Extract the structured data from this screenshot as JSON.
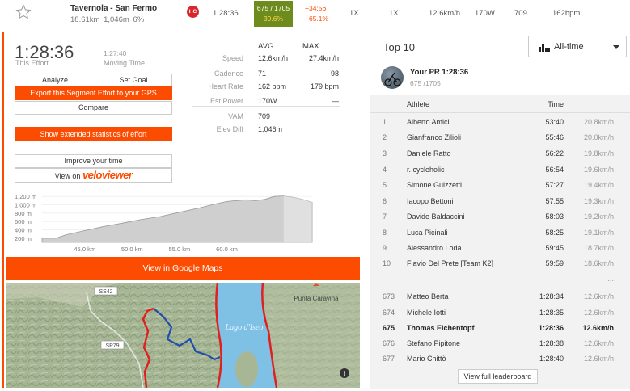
{
  "segment": {
    "name": "Tavernola - San Fermo",
    "distance": "18.61km",
    "elevation": "1,046m",
    "grade": "6%",
    "category": "HC"
  },
  "top_bar": {
    "time": "1:28:36",
    "rank": "675 / 1705",
    "rank_pct": "39.6%",
    "diff_time": "+34:56",
    "diff_pct": "+65.1%",
    "col_a": "1X",
    "col_b": "1X",
    "speed": "12.6km/h",
    "power": "170W",
    "col_c": "709",
    "hr": "162bpm"
  },
  "effort": {
    "time": "1:28:36",
    "time_label": "This Effort",
    "moving_time": "1:27:40",
    "moving_label": "Moving Time"
  },
  "buttons": {
    "analyze": "Analyze",
    "set_goal": "Set Goal",
    "export": "Export this Segment Effort to your GPS",
    "compare": "Compare",
    "extended": "Show extended statistics of effort",
    "improve": "Improve your time",
    "view_on": "View on",
    "veloviewer": "veloviewer",
    "maps": "View in Google Maps",
    "full_leaderboard": "View full leaderboard"
  },
  "stats": {
    "avg_header": "AVG",
    "max_header": "MAX",
    "rows": [
      {
        "label": "Speed",
        "avg": "12.6km/h",
        "max": "27.4km/h"
      },
      {
        "label": "Cadence",
        "avg": "71",
        "max": "98"
      },
      {
        "label": "Heart Rate",
        "avg": "162 bpm",
        "max": "179 bpm"
      },
      {
        "label": "Est Power",
        "avg": "170W",
        "max": "—"
      },
      {
        "label": "VAM",
        "avg": "709",
        "max": ""
      },
      {
        "label": "Elev Diff",
        "avg": "1,046m",
        "max": ""
      }
    ]
  },
  "chart_data": {
    "type": "area",
    "title": "",
    "y_ticks": [
      "1,200 m",
      "1,000 m",
      "800 m",
      "600 m",
      "400 m",
      "200 m"
    ],
    "x_ticks": [
      "45.0 km",
      "50.0 km",
      "55.0 km",
      "60.0 km"
    ],
    "x": [
      40.5,
      42,
      43,
      45,
      47,
      49,
      51,
      53,
      55,
      57,
      59,
      60,
      61,
      62,
      63,
      64,
      65,
      66,
      67,
      68,
      69
    ],
    "y": [
      200,
      200,
      280,
      380,
      480,
      560,
      650,
      720,
      820,
      920,
      1030,
      1080,
      1100,
      1120,
      1100,
      1130,
      1200,
      1210,
      1180,
      1130,
      1060
    ],
    "ylim": [
      100,
      1300
    ],
    "xlim": [
      40.5,
      69
    ]
  },
  "map": {
    "labels": [
      "SS42",
      "SP79",
      "Lago d'Iseo",
      "Punta Caravina"
    ],
    "info": "i"
  },
  "leaderboard": {
    "title": "Top 10",
    "filter": "All-time",
    "pr_label": "Your PR 1:28:36",
    "pr_rank": "675 /1705",
    "headers": {
      "athlete": "Athlete",
      "time": "Time"
    },
    "top": [
      {
        "rank": "1",
        "name": "Alberto Amici",
        "time": "53:40",
        "speed": "20.8km/h"
      },
      {
        "rank": "2",
        "name": "Gianfranco Zilioli",
        "time": "55:46",
        "speed": "20.0km/h"
      },
      {
        "rank": "3",
        "name": "Daniele Ratto",
        "time": "56:22",
        "speed": "19.8km/h"
      },
      {
        "rank": "4",
        "name": "r. cycleholic",
        "time": "56:54",
        "speed": "19.6km/h"
      },
      {
        "rank": "5",
        "name": "Simone Guizzetti",
        "time": "57:27",
        "speed": "19.4km/h"
      },
      {
        "rank": "6",
        "name": "Iacopo Bettoni",
        "time": "57:55",
        "speed": "19.3km/h"
      },
      {
        "rank": "7",
        "name": "Davide Baldaccini",
        "time": "58:03",
        "speed": "19.2km/h"
      },
      {
        "rank": "8",
        "name": "Luca Picinali",
        "time": "58:25",
        "speed": "19.1km/h"
      },
      {
        "rank": "9",
        "name": "Alessandro Loda",
        "time": "59:45",
        "speed": "18.7km/h"
      },
      {
        "rank": "10",
        "name": "Flavio Del Prete [Team K2]",
        "time": "59:59",
        "speed": "18.6km/h"
      }
    ],
    "ellipsis": "...",
    "around": [
      {
        "rank": "673",
        "name": "Matteo Berta",
        "time": "1:28:34",
        "speed": "12.6km/h"
      },
      {
        "rank": "674",
        "name": "Michele Iotti",
        "time": "1:28:35",
        "speed": "12.6km/h"
      },
      {
        "rank": "675",
        "name": "Thomas Eichentopf",
        "time": "1:28:36",
        "speed": "12.6km/h"
      },
      {
        "rank": "676",
        "name": "Stefano Pipitone",
        "time": "1:28:38",
        "speed": "12.6km/h"
      },
      {
        "rank": "677",
        "name": "Mario Chittò",
        "time": "1:28:40",
        "speed": "12.6km/h"
      }
    ]
  }
}
